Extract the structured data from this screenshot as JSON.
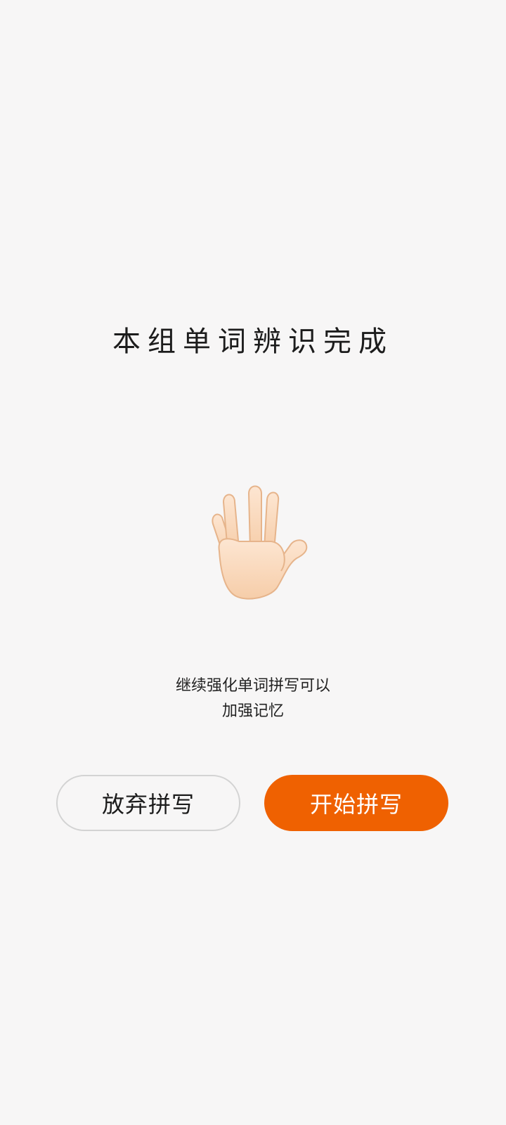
{
  "screen": {
    "title": "本组单词辨识完成",
    "illustration_icon": "vulcan-salute-hand-icon",
    "message_line1": "继续强化单词拼写可以",
    "message_line2": "加强记忆"
  },
  "actions": {
    "abandon_label": "放弃拼写",
    "start_label": "开始拼写"
  },
  "colors": {
    "background": "#f7f6f6",
    "accent": "#ef6101",
    "text": "#1c1c1c",
    "outline": "#d3d3d3"
  }
}
